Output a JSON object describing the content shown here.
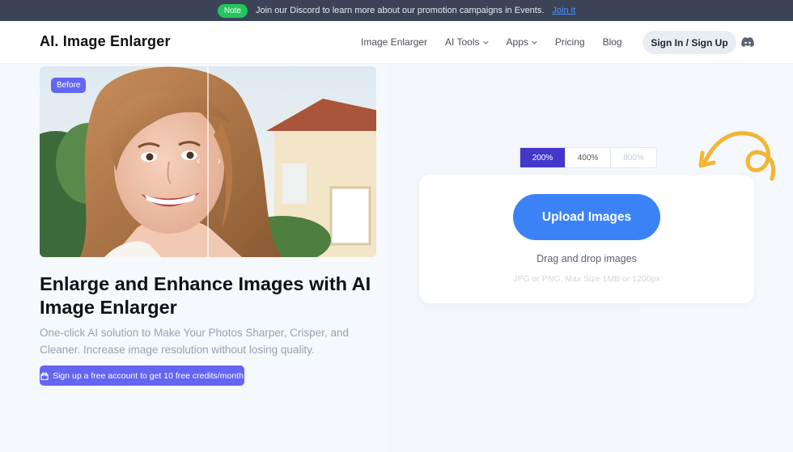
{
  "announcement": {
    "badge": "Note",
    "text": "Join our Discord to learn more about our promotion campaigns in Events.",
    "link": "Join it"
  },
  "header": {
    "logo": "AI. Image Enlarger",
    "nav": [
      {
        "label": "Image Enlarger",
        "has_dropdown": false
      },
      {
        "label": "AI Tools",
        "has_dropdown": true
      },
      {
        "label": "Apps",
        "has_dropdown": true
      },
      {
        "label": "Pricing",
        "has_dropdown": false
      },
      {
        "label": "Blog",
        "has_dropdown": false
      }
    ],
    "signin_label": "Sign In / Sign Up"
  },
  "hero": {
    "before_label": "Before",
    "headline": "Enlarge and Enhance Images with AI Image Enlarger",
    "subhead": "One-click AI solution to Make Your Photos Sharper, Crisper, and Cleaner. Increase image resolution without losing quality.",
    "signup_cta": "Sign up a free account to get 10 free credits/month"
  },
  "uploader": {
    "scales": [
      {
        "label": "200%",
        "active": true
      },
      {
        "label": "400%",
        "active": false
      },
      {
        "label": "800%",
        "active": false
      }
    ],
    "upload_label": "Upload Images",
    "drag_text": "Drag and drop images",
    "limit_text": "JPG or PNG. Max Size 1MB or 1200px"
  },
  "colors": {
    "accent_blue": "#3b82f6",
    "accent_indigo": "#6366f1",
    "note_green": "#22c55e",
    "arrow_yellow": "#f2b632"
  }
}
